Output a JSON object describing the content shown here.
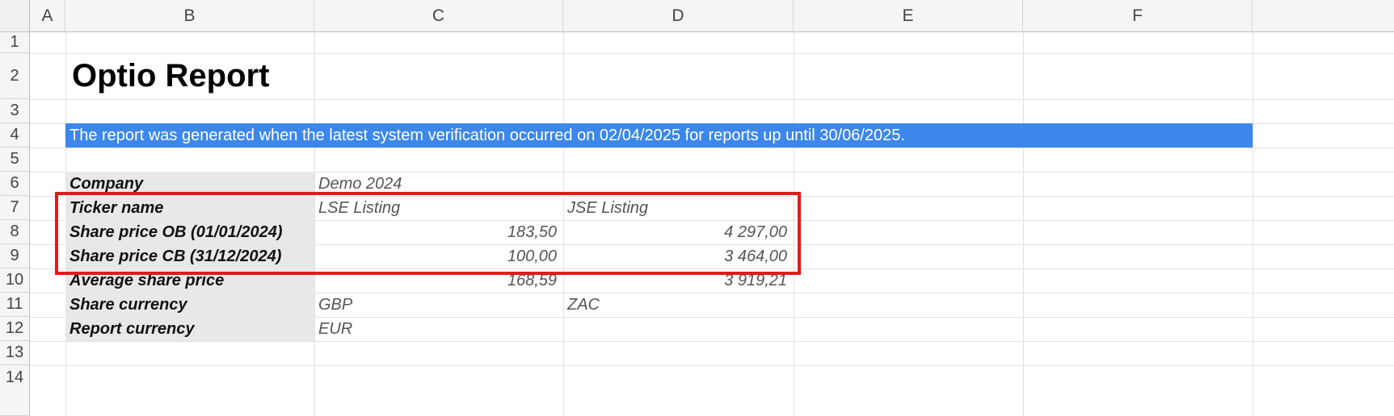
{
  "columns": [
    "A",
    "B",
    "C",
    "D",
    "E",
    "F"
  ],
  "rows": [
    "1",
    "2",
    "3",
    "4",
    "5",
    "6",
    "7",
    "8",
    "9",
    "10",
    "11",
    "12",
    "13",
    "14"
  ],
  "title": "Optio Report",
  "banner": "The report was generated when the latest system verification occurred on 02/04/2025 for reports up until 30/06/2025.",
  "table": {
    "company": {
      "label": "Company",
      "c": "Demo 2024"
    },
    "ticker": {
      "label": "Ticker name",
      "c": "LSE Listing",
      "d": "JSE Listing"
    },
    "ob": {
      "label": "Share price OB (01/01/2024)",
      "c": "183,50",
      "d": "4 297,00"
    },
    "cb": {
      "label": "Share price CB (31/12/2024)",
      "c": "100,00",
      "d": "3 464,00"
    },
    "avg": {
      "label": "Average share price",
      "c": "168,59",
      "d": "3 919,21"
    },
    "share_currency": {
      "label": "Share currency",
      "c": "GBP",
      "d": "ZAC"
    },
    "report_currency": {
      "label": "Report currency",
      "c": "EUR"
    }
  },
  "colors": {
    "banner": "#3d87ea",
    "label_fill": "#e7e8ea",
    "highlight": "#e11b1b"
  }
}
